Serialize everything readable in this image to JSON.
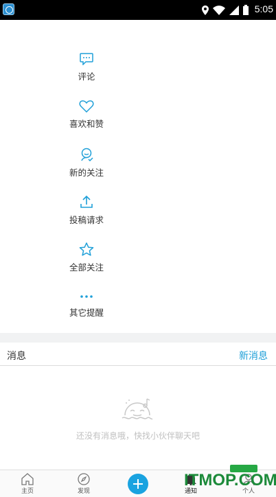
{
  "status_bar": {
    "time": "5:05"
  },
  "menu": {
    "items": [
      {
        "label": "评论",
        "icon": "comment-icon"
      },
      {
        "label": "喜欢和赞",
        "icon": "heart-icon"
      },
      {
        "label": "新的关注",
        "icon": "follow-icon"
      },
      {
        "label": "投稿请求",
        "icon": "upload-icon"
      },
      {
        "label": "全部关注",
        "icon": "star-icon"
      },
      {
        "label": "其它提醒",
        "icon": "more-dots-icon"
      }
    ]
  },
  "messages": {
    "title": "消息",
    "new_label": "新消息",
    "empty_text": "还没有消息哦，快找小伙伴聊天吧"
  },
  "tabbar": {
    "tabs": [
      {
        "label": "主页",
        "icon": "home-icon"
      },
      {
        "label": "发现",
        "icon": "compass-icon"
      },
      {
        "label": "",
        "icon": "plus-icon"
      },
      {
        "label": "通知",
        "icon": "bell-icon",
        "active": true
      },
      {
        "label": "个人",
        "icon": "person-icon"
      }
    ]
  },
  "watermark": {
    "text": "ITMOP.COM"
  },
  "colors": {
    "accent": "#1e9fd8",
    "text": "#333333",
    "muted": "#c0c0c0"
  }
}
